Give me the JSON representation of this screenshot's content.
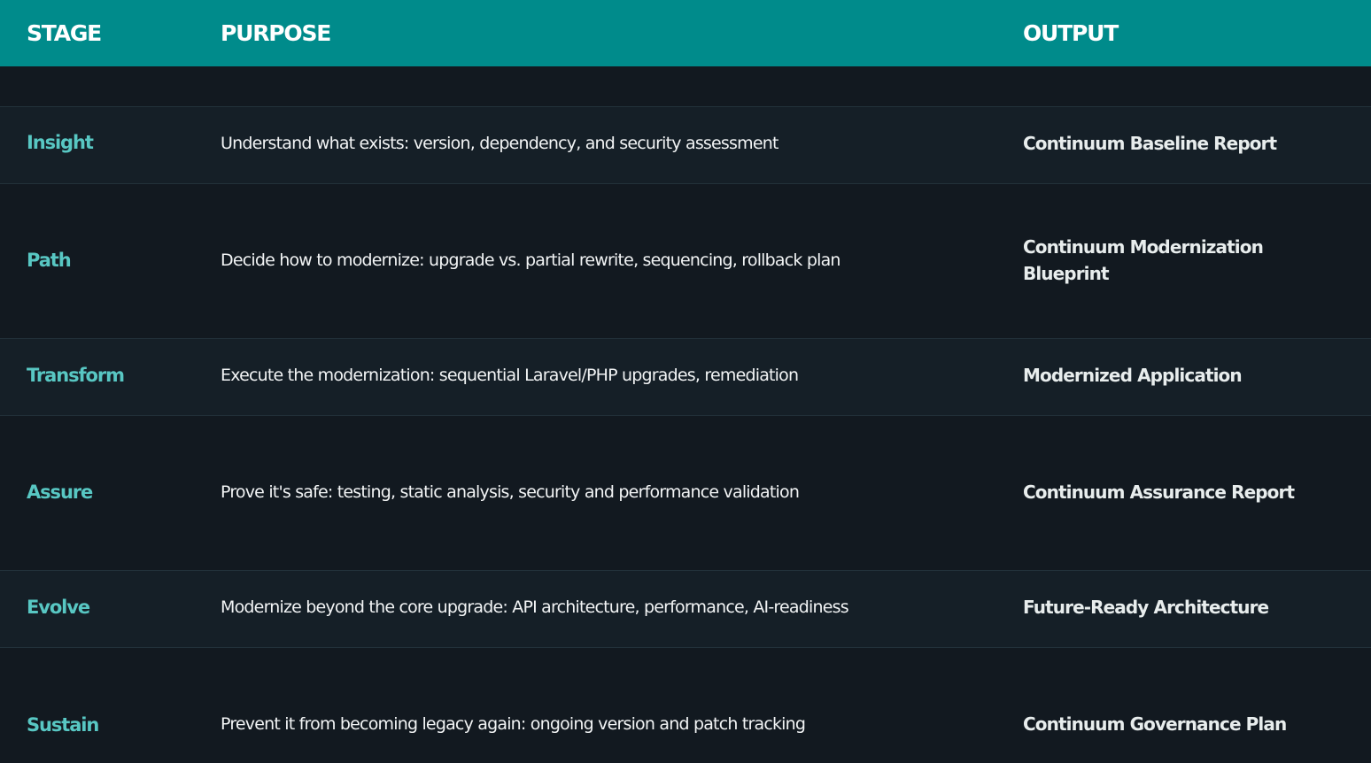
{
  "headers": {
    "stage": "STAGE",
    "purpose": "PURPOSE",
    "output": "OUTPUT"
  },
  "rows": [
    {
      "stage": "Insight",
      "purpose": "Understand what exists: version, dependency, and security assessment",
      "output": "Continuum Baseline Report"
    },
    {
      "stage": "Path",
      "purpose": "Decide how to modernize: upgrade vs. partial rewrite, sequencing, rollback plan",
      "output": "Continuum Modernization Blueprint"
    },
    {
      "stage": "Transform",
      "purpose": "Execute the modernization: sequential Laravel/PHP upgrades, remediation",
      "output": "Modernized Application"
    },
    {
      "stage": "Assure",
      "purpose": "Prove it's safe: testing, static analysis, security and performance validation",
      "output": "Continuum Assurance Report"
    },
    {
      "stage": "Evolve",
      "purpose": "Modernize beyond the core upgrade: API architecture, performance, AI-readiness",
      "output": "Future-Ready Architecture"
    },
    {
      "stage": "Sustain",
      "purpose": "Prevent it from becoming legacy again: ongoing version and patch tracking",
      "output": "Continuum Governance Plan"
    }
  ],
  "colors": {
    "header_background": "#008b8b",
    "page_background": "#121920",
    "row_alternate_background": "#151f27",
    "stage_text": "#58c7c3",
    "body_text": "#f2f4f5"
  }
}
